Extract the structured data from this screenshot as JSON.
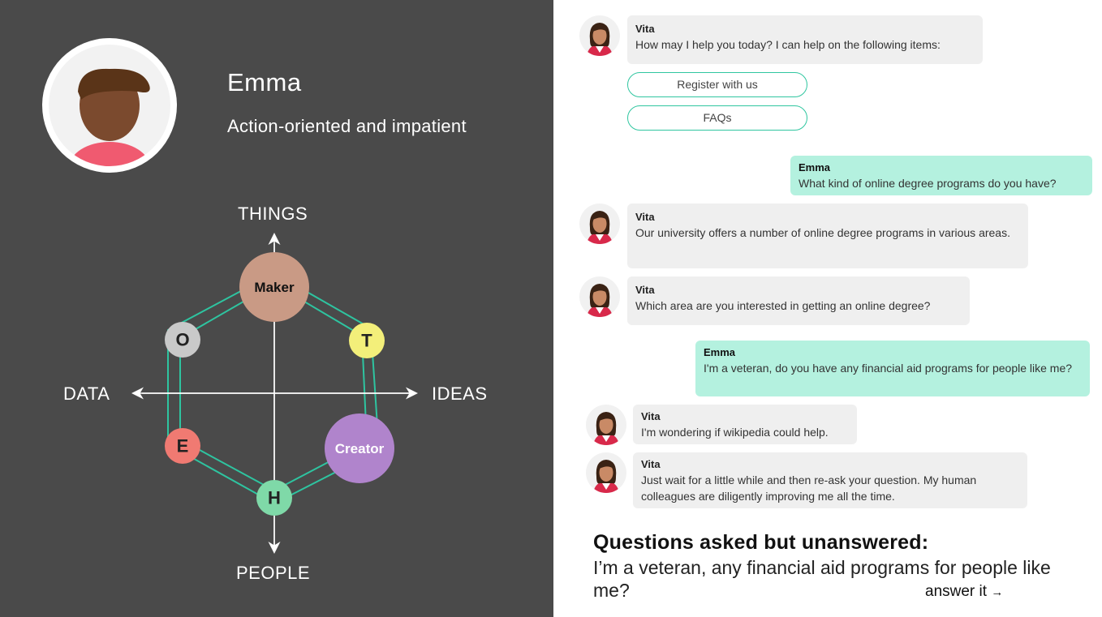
{
  "persona": {
    "name": "Emma",
    "trait": "Action-oriented and impatient",
    "avatar": "persona-avatar",
    "colors": {
      "skin": "#7b4a2e",
      "hair": "#5a3418",
      "shirt": "#f05a70"
    }
  },
  "model": {
    "axes": {
      "top": "THINGS",
      "bottom": "PEOPLE",
      "left": "DATA",
      "right": "IDEAS"
    },
    "nodes": [
      {
        "label": "Maker",
        "color": "#c99a85",
        "text_color": "#111111"
      },
      {
        "label": "T",
        "color": "#f3ef7a",
        "text_color": "#222222"
      },
      {
        "label": "Creator",
        "color": "#b084cc",
        "text_color": "#ffffff"
      },
      {
        "label": "H",
        "color": "#7fd9a8",
        "text_color": "#222222"
      },
      {
        "label": "E",
        "color": "#f07a72",
        "text_color": "#222222"
      },
      {
        "label": "O",
        "color": "#c9c9c9",
        "text_color": "#222222"
      }
    ],
    "ring_color": "#2ec4a0"
  },
  "chat": {
    "bot_name": "Vita",
    "user_name": "Emma",
    "messages": [
      {
        "from": "Vita",
        "text": "How may I help you today? I can help on the following items:"
      },
      {
        "from": "Emma",
        "text": "What kind of online degree programs do you have?"
      },
      {
        "from": "Vita",
        "text": "Our university offers a number of online degree programs in various areas."
      },
      {
        "from": "Vita",
        "text": "Which area are you interested in getting an online degree?"
      },
      {
        "from": "Emma",
        "text": "I'm a veteran, do you have any financial aid programs for people like me?"
      },
      {
        "from": "Vita",
        "text": "I'm wondering if wikipedia could help."
      },
      {
        "from": "Vita",
        "text": "Just wait for a little while and then re-ask your question. My human colleagues are diligently improving me all the time."
      }
    ],
    "options": [
      "Register with us",
      "FAQs"
    ],
    "colors": {
      "bot_bubble": "#efefef",
      "user_bubble": "#b4f1df",
      "accent": "#30c6a0"
    }
  },
  "unanswered": {
    "title": "Questions asked but unanswered:",
    "question": "I’m a veteran, any financial aid programs for people like me?",
    "action": "answer it",
    "action_icon": "arrow-right-icon"
  }
}
